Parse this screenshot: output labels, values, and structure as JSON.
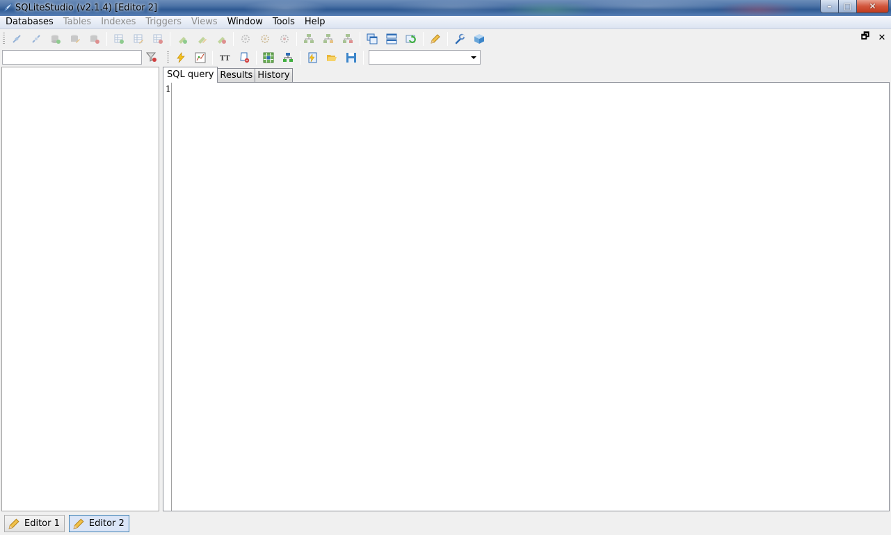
{
  "window": {
    "title": "SQLiteStudio (v2.1.4) [Editor 2]",
    "controls": {
      "minimize": "–",
      "maximize": "□",
      "close": "✕"
    }
  },
  "menubar": {
    "items": [
      {
        "label": "Databases",
        "enabled": true
      },
      {
        "label": "Tables",
        "enabled": false
      },
      {
        "label": "Indexes",
        "enabled": false
      },
      {
        "label": "Triggers",
        "enabled": false
      },
      {
        "label": "Views",
        "enabled": false
      },
      {
        "label": "Window",
        "enabled": true
      },
      {
        "label": "Tools",
        "enabled": true
      },
      {
        "label": "Help",
        "enabled": true
      }
    ]
  },
  "mdi": {
    "restore": "🗗",
    "close": "✕"
  },
  "filter": {
    "value": "",
    "placeholder": ""
  },
  "database_combo": {
    "selected": ""
  },
  "tabs": [
    {
      "label": "SQL query",
      "active": true
    },
    {
      "label": "Results",
      "active": false
    },
    {
      "label": "History",
      "active": false
    }
  ],
  "editor": {
    "line_numbers": [
      "1"
    ],
    "content": ""
  },
  "taskbar": {
    "windows": [
      {
        "label": "Editor 1",
        "active": false
      },
      {
        "label": "Editor 2",
        "active": true
      }
    ]
  },
  "colors": {
    "titlebar": "#4f75a8",
    "accent": "#3c7fb1",
    "close_button": "#c03a1d"
  }
}
